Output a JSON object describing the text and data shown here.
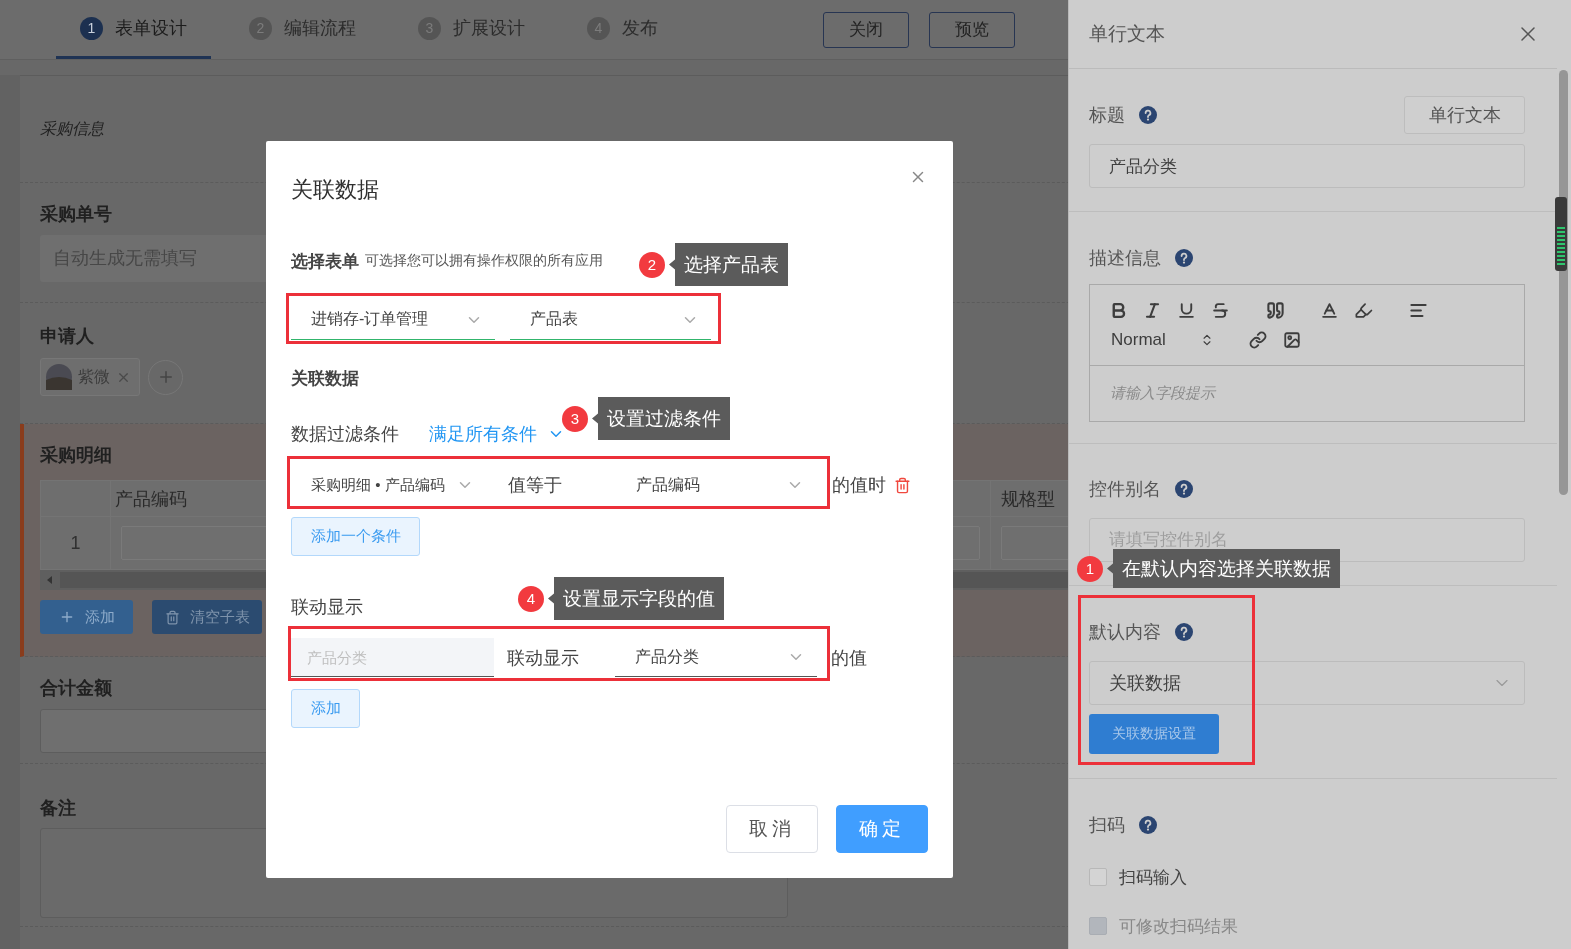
{
  "header": {
    "steps": [
      {
        "number": "1",
        "label": "表单设计",
        "selected": true
      },
      {
        "number": "2",
        "label": "编辑流程",
        "selected": false
      },
      {
        "number": "3",
        "label": "扩展设计",
        "selected": false
      },
      {
        "number": "4",
        "label": "发布",
        "selected": false
      }
    ],
    "buttons": [
      "关闭",
      "预览"
    ]
  },
  "form": {
    "section_title": "采购信息",
    "fields": [
      {
        "kind": "text",
        "label": "采购单号",
        "placeholder": "自动生成无需填写"
      },
      {
        "kind": "members",
        "label": "申请人",
        "members": [
          "紫微"
        ]
      },
      {
        "kind": "subform",
        "label": "采购明细",
        "columns": [
          "产品编码",
          "规格型"
        ],
        "rows": [
          "1"
        ],
        "buttons": [
          "添加",
          "清空子表"
        ]
      },
      {
        "kind": "number",
        "label": "合计金额"
      },
      {
        "kind": "textarea",
        "label": "备注"
      }
    ]
  },
  "dialog": {
    "title": "关联数据",
    "form_select": {
      "label": "选择表单",
      "hint": "可选择您可以拥有操作权限的所有应用",
      "app": "进销存-订单管理",
      "form": "产品表"
    },
    "section_title": "关联数据",
    "filter": {
      "label": "数据过滤条件",
      "match": "满足所有条件",
      "conditions": [
        {
          "field": "采购明细 • 产品编码",
          "operator": "值等于",
          "value": "产品编码",
          "suffix": "的值时"
        }
      ],
      "add_button": "添加一个条件"
    },
    "linkage": {
      "label": "联动显示",
      "rows": [
        {
          "placeholder": "产品分类",
          "operator": "联动显示",
          "value": "产品分类",
          "suffix": "的值"
        }
      ],
      "add_button": "添加"
    },
    "buttons": [
      {
        "label": "取消",
        "kind": "default"
      },
      {
        "label": "确定",
        "kind": "primary"
      }
    ]
  },
  "panel": {
    "title": "单行文本",
    "title_field": {
      "label": "标题",
      "button": "单行文本",
      "value": "产品分类"
    },
    "description": {
      "label": "描述信息",
      "style_select": "Normal",
      "placeholder": "请输入字段提示"
    },
    "alias": {
      "label": "控件别名",
      "placeholder": "请填写控件别名"
    },
    "default": {
      "label": "默认内容",
      "value": "关联数据",
      "button": "关联数据设置"
    },
    "scan": {
      "label": "扫码",
      "options": [
        {
          "label": "扫码输入",
          "checked": false,
          "disabled": false
        },
        {
          "label": "可修改扫码结果",
          "checked": false,
          "disabled": true
        }
      ]
    }
  },
  "annotations": [
    {
      "number": "1",
      "text": "在默认内容选择关联数据"
    },
    {
      "number": "2",
      "text": "选择产品表"
    },
    {
      "number": "3",
      "text": "设置过滤条件"
    },
    {
      "number": "4",
      "text": "设置显示字段的值"
    }
  ]
}
